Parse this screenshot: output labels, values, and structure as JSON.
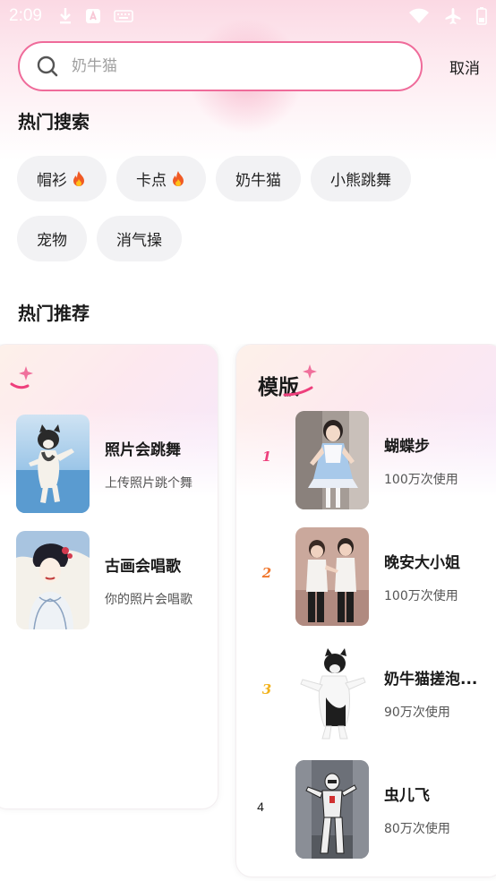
{
  "status_bar": {
    "time": "2:09",
    "icons": [
      "download-icon",
      "app-store-icon",
      "keyboard-icon",
      "wifi-icon",
      "airplane-icon",
      "battery-icon"
    ]
  },
  "search": {
    "placeholder": "奶牛猫",
    "value": "",
    "cancel_label": "取消"
  },
  "hot_search": {
    "title": "热门搜索",
    "chips": [
      {
        "label": "帽衫",
        "hot": true
      },
      {
        "label": "卡点",
        "hot": true
      },
      {
        "label": "奶牛猫",
        "hot": false
      },
      {
        "label": "小熊跳舞",
        "hot": false
      },
      {
        "label": "宠物",
        "hot": false
      },
      {
        "label": "消气操",
        "hot": false
      }
    ]
  },
  "hot_recommend": {
    "title": "热门推荐",
    "card1": {
      "items": [
        {
          "title": "照片会跳舞",
          "subtitle": "上传照片跳个舞",
          "thumb": "dancing-cat"
        },
        {
          "title": "古画会唱歌",
          "subtitle": "你的照片会唱歌",
          "thumb": "ancient-painting"
        }
      ]
    },
    "card2": {
      "heading": "模版",
      "items": [
        {
          "rank": "1",
          "title": "蝴蝶步",
          "subtitle": "100万次使用",
          "thumb": "girl-lolita-dress"
        },
        {
          "rank": "2",
          "title": "晚安大小姐",
          "subtitle": "100万次使用",
          "thumb": "two-boys-dancing"
        },
        {
          "rank": "3",
          "title": "奶牛猫搓泡...",
          "subtitle": "90万次使用",
          "thumb": "cow-cat"
        },
        {
          "rank": "4",
          "title": "虫儿飞",
          "subtitle": "80万次使用",
          "thumb": "robot"
        }
      ]
    }
  },
  "colors": {
    "accent": "#ef6b9a",
    "chip_bg": "#f2f2f4",
    "rank1": "#ee3f7c",
    "rank2": "#f0762c",
    "rank3": "#f2b21b"
  }
}
